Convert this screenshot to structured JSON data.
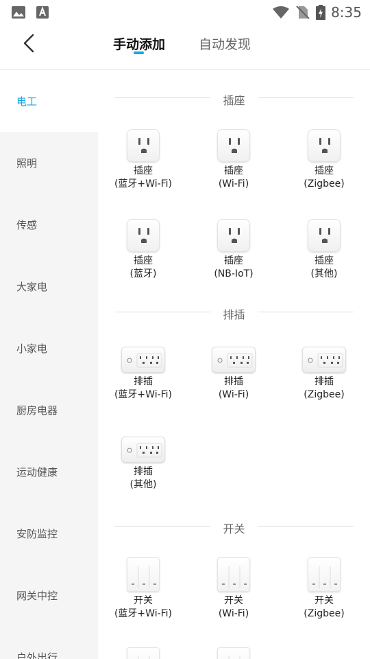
{
  "status_bar": {
    "time": "8:35",
    "icons": [
      "image-icon",
      "font-icon",
      "wifi-icon",
      "no-sim-icon",
      "battery-charging-icon"
    ]
  },
  "header": {
    "tabs": [
      {
        "label": "手动添加",
        "active": true
      },
      {
        "label": "自动发现",
        "active": false
      }
    ]
  },
  "sidebar": {
    "items": [
      {
        "label": "电工",
        "active": true
      },
      {
        "label": "照明"
      },
      {
        "label": "传感"
      },
      {
        "label": "大家电"
      },
      {
        "label": "小家电"
      },
      {
        "label": "厨房电器"
      },
      {
        "label": "运动健康"
      },
      {
        "label": "安防监控"
      },
      {
        "label": "网关中控"
      },
      {
        "label": "户外出行"
      }
    ]
  },
  "sections": [
    {
      "title": "插座",
      "icon": "socket-icon",
      "devices": [
        {
          "name": "插座",
          "sub": "(蓝牙+Wi-Fi)"
        },
        {
          "name": "插座",
          "sub": "(Wi-Fi)"
        },
        {
          "name": "插座",
          "sub": "(Zigbee)"
        },
        {
          "name": "插座",
          "sub": "(蓝牙)"
        },
        {
          "name": "插座",
          "sub": "(NB-IoT)"
        },
        {
          "name": "插座",
          "sub": "(其他)"
        }
      ]
    },
    {
      "title": "排插",
      "icon": "power-strip-icon",
      "devices": [
        {
          "name": "排插",
          "sub": "(蓝牙+Wi-Fi)"
        },
        {
          "name": "排插",
          "sub": "(Wi-Fi)"
        },
        {
          "name": "排插",
          "sub": "(Zigbee)"
        },
        {
          "name": "排插",
          "sub": "(其他)"
        }
      ]
    },
    {
      "title": "开关",
      "icon": "wall-switch-icon",
      "devices": [
        {
          "name": "开关",
          "sub": "(蓝牙+Wi-Fi)"
        },
        {
          "name": "开关",
          "sub": "(Wi-Fi)"
        },
        {
          "name": "开关",
          "sub": "(Zigbee)"
        }
      ]
    }
  ],
  "colors": {
    "accent": "#19a5e0",
    "sidebar_bg": "#f5f5f5",
    "divider": "#dddddd"
  }
}
